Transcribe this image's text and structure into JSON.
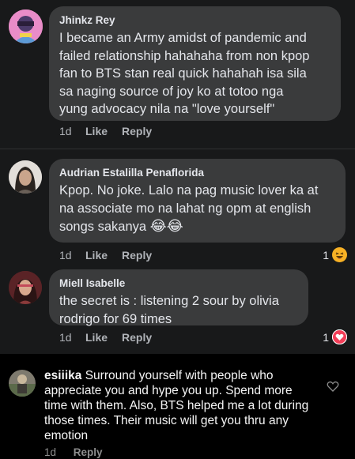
{
  "comments": [
    {
      "name": "Jhinkz Rey",
      "text": "I became an Army amidst of pandemic and\nfailed relationship hahahaha from non kpop\nfan to BTS stan real quick hahahah isa sila\nsa naging source of joy ko at totoo nga\nyung advocacy nila na \"love yourself\"",
      "time": "1d",
      "like": "Like",
      "reply": "Reply"
    },
    {
      "name": "Audrian Estalilla Penaflorida",
      "text": "Kpop. No joke. Lalo na pag music lover ka at\nna associate mo na lahat ng opm at english\nsongs sakanya",
      "emoji": "😂😂",
      "time": "1d",
      "like": "Like",
      "reply": "Reply",
      "reaction_count": "1",
      "reaction_icon": "haha-icon"
    },
    {
      "name": "Miell Isabelle",
      "text": "the secret is : listening 2 sour by olivia\nrodrigo for 69 times",
      "time": "1d",
      "like": "Like",
      "reply": "Reply",
      "reaction_count": "1",
      "reaction_icon": "love-icon"
    }
  ],
  "instagram": {
    "username": "esiiika",
    "text": " Surround yourself with people who appreciate you and hype you up. Spend more time with them. Also, BTS helped me a lot during those times. Their music will get you thru any emotion",
    "time": "1d",
    "reply": "Reply",
    "icon": "heart-outline-icon"
  },
  "colors": {
    "fb_bg": "#18191a",
    "bubble": "#3a3b3c",
    "meta": "#b0b3b8",
    "ig_bg": "#000000",
    "love": "#f33e58",
    "haha": "#f7b125"
  }
}
